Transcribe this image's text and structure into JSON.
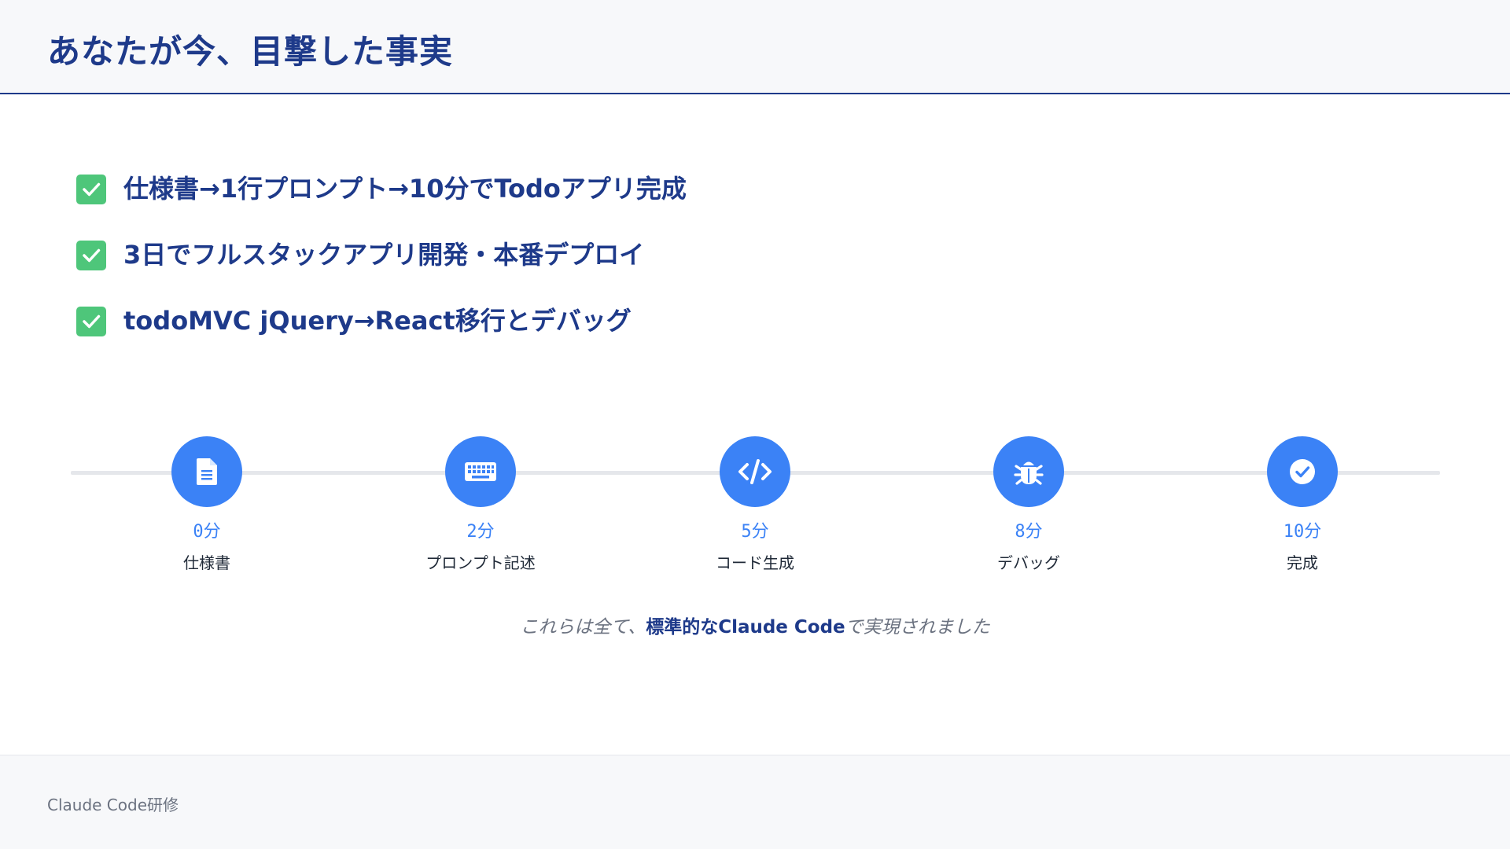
{
  "header": {
    "title": "あなたが今、目撃した事実"
  },
  "checklist": {
    "items": [
      {
        "label": "仕様書→1行プロンプト→10分でTodoアプリ完成",
        "checked": true
      },
      {
        "label": "3日でフルスタックアプリ開発・本番デプロイ",
        "checked": true
      },
      {
        "label": "todoMVC jQuery→React移行とデバッグ",
        "checked": true
      }
    ],
    "check_color": "#4ec67a"
  },
  "timeline": {
    "accent_color": "#3b82f6",
    "steps": [
      {
        "time": "0分",
        "label": "仕様書",
        "icon": "document-icon"
      },
      {
        "time": "2分",
        "label": "プロンプト記述",
        "icon": "keyboard-icon"
      },
      {
        "time": "5分",
        "label": "コード生成",
        "icon": "code-icon"
      },
      {
        "time": "8分",
        "label": "デバッグ",
        "icon": "bug-icon"
      },
      {
        "time": "10分",
        "label": "完成",
        "icon": "check-circle-icon"
      }
    ]
  },
  "caption": {
    "pre": "これらは全て、",
    "strong": "標準的なClaude Code",
    "post": "で実現されました"
  },
  "footer": {
    "text": "Claude Code研修"
  }
}
